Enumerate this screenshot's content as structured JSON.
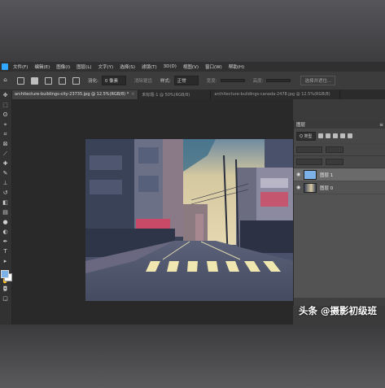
{
  "menu": {
    "items": [
      "文件(F)",
      "编辑(E)",
      "图像(I)",
      "图层(L)",
      "文字(Y)",
      "选择(S)",
      "滤镜(T)",
      "3D(D)",
      "视图(V)",
      "窗口(W)",
      "帮助(H)"
    ]
  },
  "options": {
    "feather_label": "羽化:",
    "feather_value": "0 像素",
    "antialias_label": "消除锯齿",
    "style_label": "样式:",
    "style_value": "正常",
    "width_label": "宽度:",
    "height_label": "高度:",
    "select_mask_label": "选择并遮住..."
  },
  "tabs": [
    {
      "label": "architecture-buildings-city-23735.jpg @ 12.5%(RGB/8) *",
      "active": true
    },
    {
      "label": "未标题-1 @ 50%(RGB/8)",
      "active": false
    },
    {
      "label": "architecture-buildings-canada-2478.jpg @ 12.5%(RGB/8)",
      "active": false
    }
  ],
  "layers_panel": {
    "title": "图层",
    "filter_value": "Q 类型",
    "layers": [
      {
        "name": "图层 1",
        "thumb": "blue",
        "selected": true
      },
      {
        "name": "图层 0",
        "thumb": "photo",
        "selected": false
      }
    ]
  },
  "watermark": "头条 @摄影初级班",
  "colors": {
    "foreground": "#7db2e8",
    "background": "#ffffff",
    "ps_blue": "#31a8ff"
  }
}
